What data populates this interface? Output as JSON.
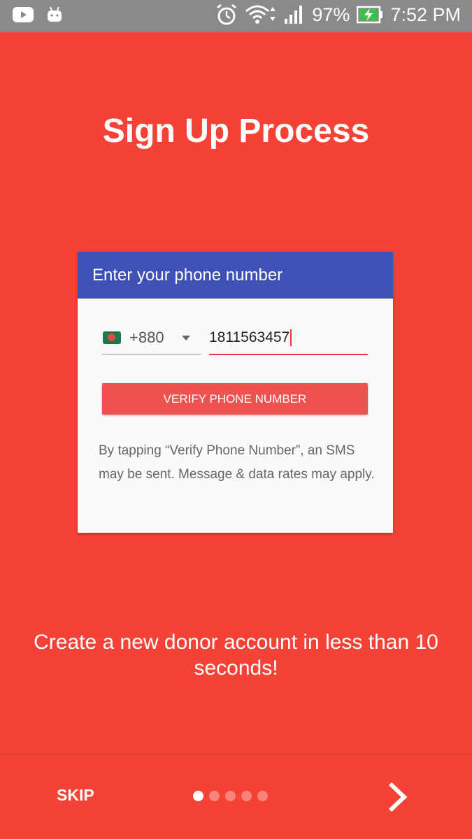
{
  "status_bar": {
    "battery": "97%",
    "time": "7:52 PM"
  },
  "title": "Sign Up Process",
  "card": {
    "header": "Enter your phone number",
    "country_code": "+880",
    "phone_value": "1811563457",
    "verify_label": "VERIFY PHONE NUMBER",
    "disclaimer": "By tapping “Verify Phone Number”, an SMS may be sent. Message & data rates may apply."
  },
  "tagline": "Create a new donor account in less than 10 seconds!",
  "footer": {
    "skip_label": "SKIP",
    "page_count": 5,
    "active_page": 1
  },
  "colors": {
    "background": "#f44336",
    "card_header": "#3f51b5",
    "button": "#ef5350"
  }
}
